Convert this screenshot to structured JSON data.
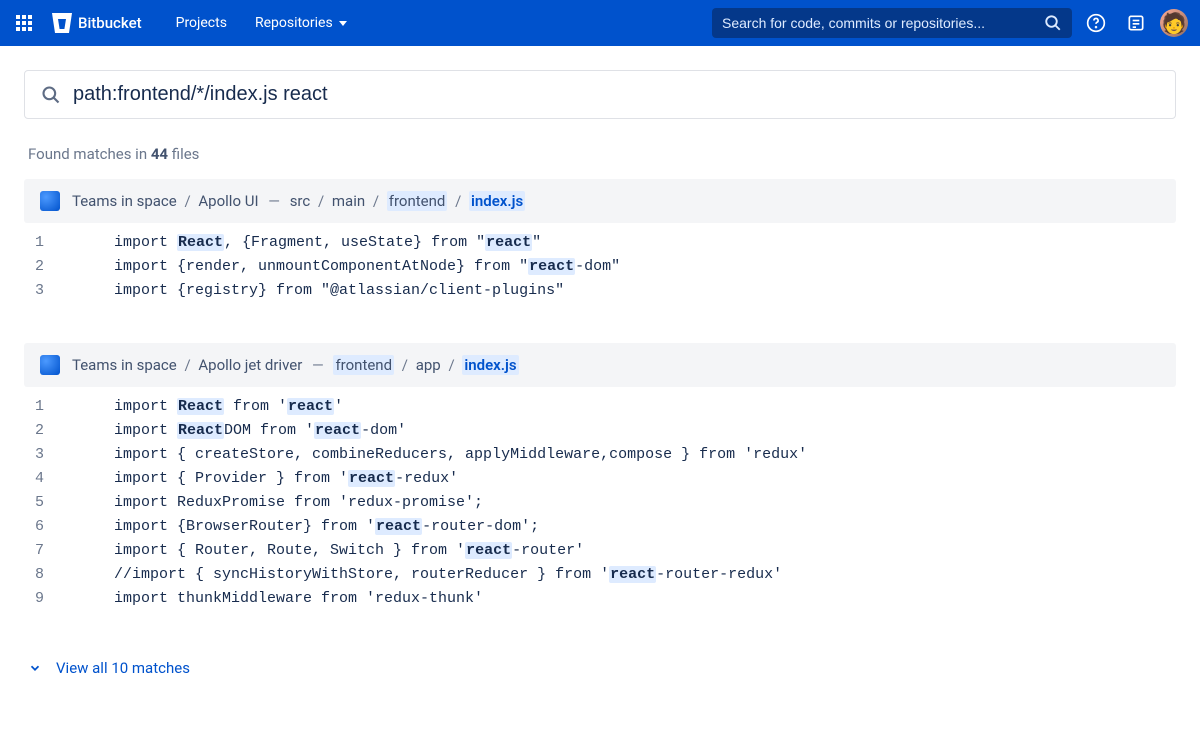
{
  "header": {
    "brand": "Bitbucket",
    "nav": {
      "projects": "Projects",
      "repositories": "Repositories"
    },
    "search_placeholder": "Search for code, commits or repositories..."
  },
  "search": {
    "query": "path:frontend/*/index.js react"
  },
  "summary": {
    "prefix": "Found matches in ",
    "count": "44",
    "suffix": " files"
  },
  "results": [
    {
      "project": "Teams in space",
      "repo": "Apollo UI",
      "path_segments": [
        {
          "text": "src",
          "hl": false
        },
        {
          "text": "main",
          "hl": false
        },
        {
          "text": "frontend",
          "hl": true
        },
        {
          "text": "index.js",
          "hl": true,
          "file": true
        }
      ],
      "lines": [
        {
          "n": 1,
          "segments": [
            {
              "t": "import "
            },
            {
              "t": "React",
              "hl": true
            },
            {
              "t": ", {Fragment, useState} from \""
            },
            {
              "t": "react",
              "hl": true
            },
            {
              "t": "\""
            }
          ]
        },
        {
          "n": 2,
          "segments": [
            {
              "t": "import {render, unmountComponentAtNode} from \""
            },
            {
              "t": "react",
              "hl": true
            },
            {
              "t": "-dom\""
            }
          ]
        },
        {
          "n": 3,
          "segments": [
            {
              "t": "import {registry} from \"@atlassian/client-plugins\""
            }
          ]
        }
      ]
    },
    {
      "project": "Teams in space",
      "repo": "Apollo jet driver",
      "path_segments": [
        {
          "text": "frontend",
          "hl": true
        },
        {
          "text": "app",
          "hl": false
        },
        {
          "text": "index.js",
          "hl": true,
          "file": true
        }
      ],
      "lines": [
        {
          "n": 1,
          "segments": [
            {
              "t": "import "
            },
            {
              "t": "React",
              "hl": true
            },
            {
              "t": " from '"
            },
            {
              "t": "react",
              "hl": true
            },
            {
              "t": "'"
            }
          ]
        },
        {
          "n": 2,
          "segments": [
            {
              "t": "import "
            },
            {
              "t": "React",
              "hl": true
            },
            {
              "t": "DOM from '"
            },
            {
              "t": "react",
              "hl": true
            },
            {
              "t": "-dom'"
            }
          ]
        },
        {
          "n": 3,
          "segments": [
            {
              "t": "import { createStore, combineReducers, applyMiddleware,compose } from 'redux'"
            }
          ]
        },
        {
          "n": 4,
          "segments": [
            {
              "t": "import { Provider } from '"
            },
            {
              "t": "react",
              "hl": true
            },
            {
              "t": "-redux'"
            }
          ]
        },
        {
          "n": 5,
          "segments": [
            {
              "t": "import ReduxPromise from 'redux-promise';"
            }
          ]
        },
        {
          "n": 6,
          "segments": [
            {
              "t": "import {BrowserRouter} from '"
            },
            {
              "t": "react",
              "hl": true
            },
            {
              "t": "-router-dom';"
            }
          ]
        },
        {
          "n": 7,
          "segments": [
            {
              "t": "import { Router, Route, Switch } from '"
            },
            {
              "t": "react",
              "hl": true
            },
            {
              "t": "-router'"
            }
          ]
        },
        {
          "n": 8,
          "segments": [
            {
              "t": "//import { syncHistoryWithStore, routerReducer } from '"
            },
            {
              "t": "react",
              "hl": true
            },
            {
              "t": "-router-redux'"
            }
          ]
        },
        {
          "n": 9,
          "segments": [
            {
              "t": "import thunkMiddleware from 'redux-thunk'"
            }
          ]
        }
      ],
      "view_all": "View all 10 matches"
    }
  ]
}
